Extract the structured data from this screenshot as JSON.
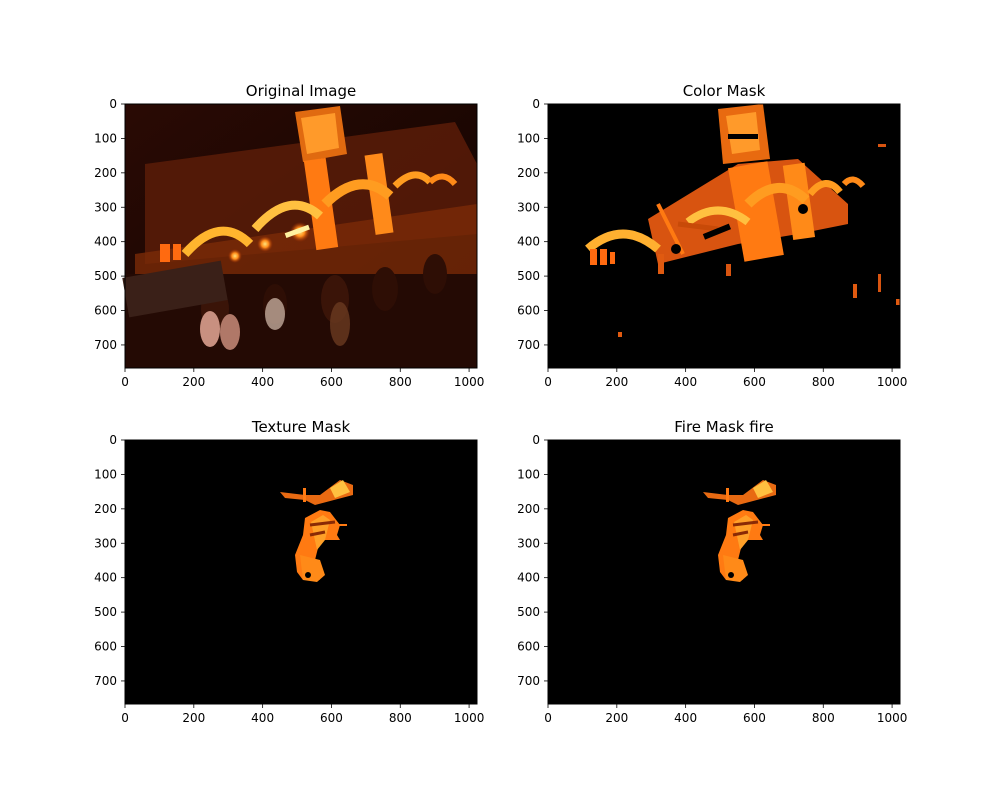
{
  "figure": {
    "background": "#ffffff",
    "panels": [
      {
        "title": "Original Image",
        "image_kind": "original-night-gate-photo",
        "background_color": "#1a0602",
        "glow_color": "#ff9a2a",
        "hot_color": "#ffe066",
        "chart_data": {
          "type": "image",
          "title": "Original Image",
          "xlim": [
            0,
            1023
          ],
          "ylim": [
            767,
            0
          ],
          "xticks": [
            0,
            200,
            400,
            600,
            800,
            1000
          ],
          "yticks": [
            0,
            100,
            200,
            300,
            400,
            500,
            600,
            700
          ]
        }
      },
      {
        "title": "Color Mask",
        "image_kind": "color-mask",
        "background_color": "#000000",
        "glow_color": "#ff8a1a",
        "hot_color": "#ffe070",
        "chart_data": {
          "type": "image",
          "title": "Color Mask",
          "xlim": [
            0,
            1023
          ],
          "ylim": [
            767,
            0
          ],
          "xticks": [
            0,
            200,
            400,
            600,
            800,
            1000
          ],
          "yticks": [
            0,
            100,
            200,
            300,
            400,
            500,
            600,
            700
          ]
        }
      },
      {
        "title": "Texture Mask",
        "image_kind": "texture-mask",
        "background_color": "#000000",
        "glow_color": "#ff8a1a",
        "hot_color": "#ffd050",
        "chart_data": {
          "type": "image",
          "title": "Texture Mask",
          "xlim": [
            0,
            1023
          ],
          "ylim": [
            767,
            0
          ],
          "xticks": [
            0,
            200,
            400,
            600,
            800,
            1000
          ],
          "yticks": [
            0,
            100,
            200,
            300,
            400,
            500,
            600,
            700
          ]
        }
      },
      {
        "title": "Fire Mask fire",
        "image_kind": "fire-mask",
        "background_color": "#000000",
        "glow_color": "#ff8a1a",
        "hot_color": "#ffd050",
        "chart_data": {
          "type": "image",
          "title": "Fire Mask fire",
          "xlim": [
            0,
            1023
          ],
          "ylim": [
            767,
            0
          ],
          "xticks": [
            0,
            200,
            400,
            600,
            800,
            1000
          ],
          "yticks": [
            0,
            100,
            200,
            300,
            400,
            500,
            600,
            700
          ]
        }
      }
    ]
  }
}
